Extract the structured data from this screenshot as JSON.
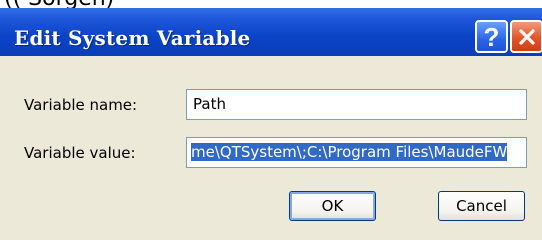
{
  "window": {
    "title": "Edit System Variable",
    "partial_top_text": "(( Sorgen)"
  },
  "form": {
    "variable_name_label": "Variable name:",
    "variable_name_value": "Path",
    "variable_value_label": "Variable value:",
    "variable_value_value": "me\\QTSystem\\;C:\\Program Files\\MaudeFW"
  },
  "buttons": {
    "ok_label": "OK",
    "cancel_label": "Cancel"
  },
  "icons": {
    "help": "help-icon",
    "close": "close-icon"
  },
  "colors": {
    "titlebar": "#0b43c7",
    "selection": "#316ac5",
    "client": "#ece9d8"
  }
}
